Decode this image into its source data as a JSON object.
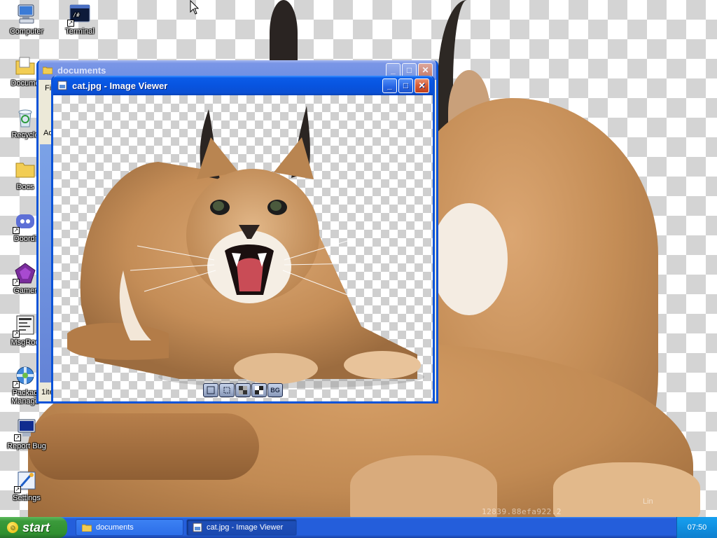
{
  "desktop": {
    "icons": [
      {
        "label": "Computer",
        "icon": "computer-icon"
      },
      {
        "label": "Terminal",
        "icon": "terminal-icon"
      },
      {
        "label": "Docume",
        "icon": "documents-icon"
      },
      {
        "label": "Recycle",
        "icon": "recycle-bin-icon"
      },
      {
        "label": "Docs",
        "icon": "folder-icon"
      },
      {
        "label": "Doordi",
        "icon": "doordish-icon"
      },
      {
        "label": "Gamer",
        "icon": "gamer-icon"
      },
      {
        "label": "MsgRoo",
        "icon": "msgroom-icon"
      },
      {
        "label": "Packag\nManage",
        "icon": "package-manager-icon"
      },
      {
        "label": "Report Bug",
        "icon": "report-bug-icon"
      },
      {
        "label": "Settings",
        "icon": "settings-icon"
      }
    ],
    "watermark": "12839.88efa922.2",
    "watermark_right": "Lin"
  },
  "windows": {
    "documents": {
      "title": "documents",
      "menu_peek": "Fi",
      "address_peek": "Ad",
      "status_peek": "1ite"
    },
    "image_viewer": {
      "title": "cat.jpg - Image Viewer",
      "toolbar": [
        {
          "name": "fit-window-button",
          "label": ""
        },
        {
          "name": "actual-size-button",
          "label": ""
        },
        {
          "name": "checker-dark-button",
          "label": ""
        },
        {
          "name": "checker-light-button",
          "label": ""
        },
        {
          "name": "background-button",
          "label": "BG"
        }
      ]
    }
  },
  "taskbar": {
    "start_label": "start",
    "tasks": [
      {
        "label": "documents",
        "active": false
      },
      {
        "label": "cat.jpg - Image Viewer",
        "active": true
      }
    ],
    "clock": "07:50"
  },
  "colors": {
    "title_active": "#0a5be8",
    "start_green": "#3b9a3b",
    "taskbar_blue": "#245edb",
    "fur": "#c08a55"
  }
}
